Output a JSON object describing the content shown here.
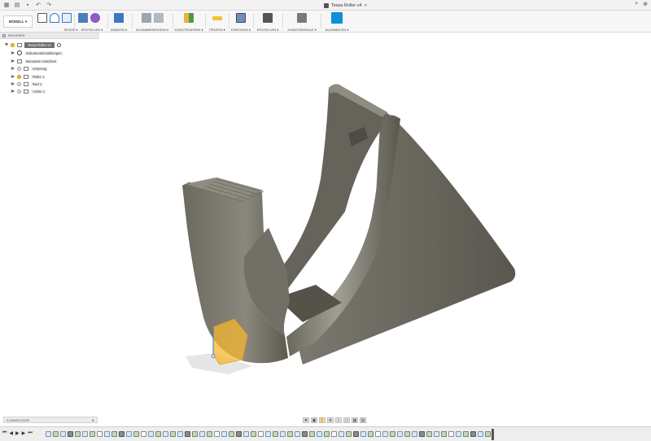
{
  "app": {
    "document_title": "Tessa Roller v4"
  },
  "toolbar": {
    "workspace_label": "MODELL",
    "groups": [
      {
        "label": "SKIZZE ▾"
      },
      {
        "label": "ERSTELLEN ▾"
      },
      {
        "label": "ÄNDERN ▾"
      },
      {
        "label": "ZUSAMMENFÜGEN ▾"
      },
      {
        "label": "KONSTRUIEREN ▾"
      },
      {
        "label": "PRÜFEN ▾"
      },
      {
        "label": "EINFÜGEN ▾"
      },
      {
        "label": "ERSTELLEN ▾"
      },
      {
        "label": "ZUSATZMODULE ▾"
      },
      {
        "label": "AUSWÄHLEN ▾"
      }
    ]
  },
  "browser": {
    "title": "BROWSER",
    "root": "Tessa Roller v4",
    "items": [
      {
        "label": "Dokumenteinstellungen",
        "icon": "gear-icon"
      },
      {
        "label": "Benannte Ansichten",
        "icon": "folder-icon"
      },
      {
        "label": "Ursprung",
        "icon": "folder-icon"
      },
      {
        "label": "Roller 1",
        "icon": "component-icon"
      },
      {
        "label": "Rad 1",
        "icon": "component-icon"
      },
      {
        "label": "Achse 1",
        "icon": "component-icon"
      }
    ]
  },
  "comments": {
    "label": "KOMMENTARE"
  },
  "colors": {
    "model_body": "#5f5c54",
    "model_highlight": "#8a877d",
    "selection": "#f5b731",
    "accent_blue": "#0e8fd6"
  }
}
